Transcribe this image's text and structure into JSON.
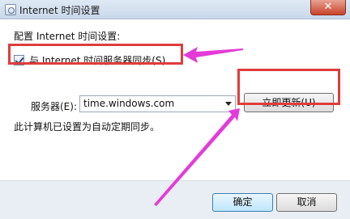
{
  "window": {
    "title": "Internet 时间设置",
    "close_glyph": "✕"
  },
  "settings": {
    "section_label": "配置 Internet 时间设置:",
    "sync_checkbox_label": "与 Internet 时间服务器同步(S)",
    "sync_checked": true,
    "server_label": "服务器(E):",
    "server_value": "time.windows.com",
    "update_button": "立即更新(U)",
    "status_text": "此计算机已设置为自动定期同步。"
  },
  "footer": {
    "ok_label": "确定",
    "cancel_label": "取消"
  },
  "annotations": {
    "highlight_color": "#e03c3c",
    "arrow_color": "#e43bd8"
  }
}
